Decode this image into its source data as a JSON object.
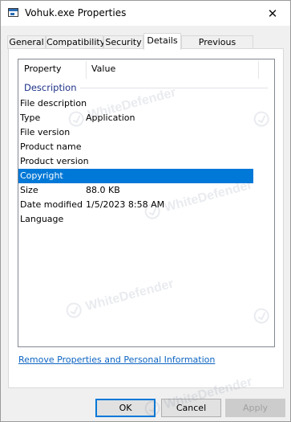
{
  "window": {
    "title": "Vohuk.exe Properties"
  },
  "tabs": [
    {
      "label": "General"
    },
    {
      "label": "Compatibility"
    },
    {
      "label": "Security"
    },
    {
      "label": "Details"
    },
    {
      "label": "Previous Versions"
    }
  ],
  "active_tab": "Details",
  "details": {
    "columns": {
      "property": "Property",
      "value": "Value"
    },
    "group": "Description",
    "rows": [
      {
        "property": "File description",
        "value": ""
      },
      {
        "property": "Type",
        "value": "Application"
      },
      {
        "property": "File version",
        "value": ""
      },
      {
        "property": "Product name",
        "value": ""
      },
      {
        "property": "Product version",
        "value": ""
      },
      {
        "property": "Copyright",
        "value": ""
      },
      {
        "property": "Size",
        "value": "88.0 KB"
      },
      {
        "property": "Date modified",
        "value": "1/5/2023 8:58 AM"
      },
      {
        "property": "Language",
        "value": ""
      }
    ],
    "selected_row": "Copyright"
  },
  "remove_link": "Remove Properties and Personal Information",
  "buttons": {
    "ok": "OK",
    "cancel": "Cancel",
    "apply": "Apply"
  },
  "watermark": {
    "text": "WhiteDefender"
  },
  "icons": {
    "close": "✕"
  },
  "colors": {
    "selection": "#0078d7",
    "link": "#0c64c1",
    "group_header": "#1e3287"
  }
}
